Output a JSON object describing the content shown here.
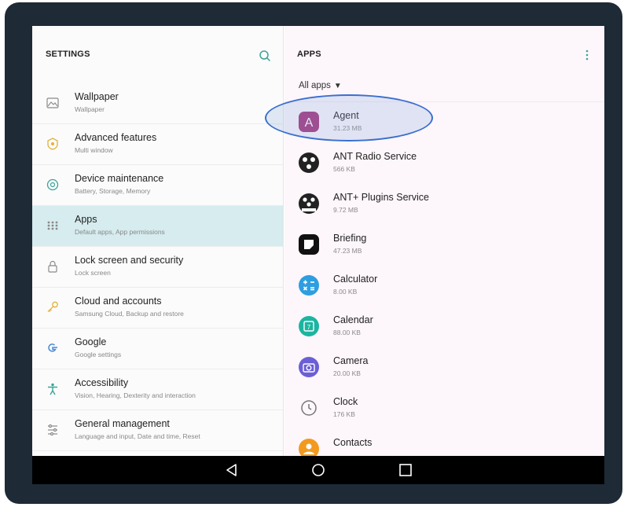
{
  "settings": {
    "title": "SETTINGS",
    "items": [
      {
        "label": "Wallpaper",
        "sub": "Wallpaper",
        "icon": "wallpaper-icon"
      },
      {
        "label": "Advanced features",
        "sub": "Multi window",
        "icon": "advanced-features-icon"
      },
      {
        "label": "Device maintenance",
        "sub": "Battery, Storage, Memory",
        "icon": "device-maintenance-icon"
      },
      {
        "label": "Apps",
        "sub": "Default apps, App permissions",
        "icon": "apps-icon",
        "selected": true
      },
      {
        "label": "Lock screen and security",
        "sub": "Lock screen",
        "icon": "lock-icon"
      },
      {
        "label": "Cloud and accounts",
        "sub": "Samsung Cloud, Backup and restore",
        "icon": "key-icon"
      },
      {
        "label": "Google",
        "sub": "Google settings",
        "icon": "google-icon"
      },
      {
        "label": "Accessibility",
        "sub": "Vision, Hearing, Dexterity and interaction",
        "icon": "accessibility-icon"
      },
      {
        "label": "General management",
        "sub": "Language and input, Date and time, Reset",
        "icon": "general-management-icon"
      }
    ]
  },
  "apps": {
    "title": "APPS",
    "filter": "All apps",
    "list": [
      {
        "name": "Agent",
        "size": "31.23 MB",
        "icon": "agent-icon",
        "color": "#a3307a"
      },
      {
        "name": "ANT Radio Service",
        "size": "566 KB",
        "icon": "ant-radio-icon",
        "color": "#222222"
      },
      {
        "name": "ANT+ Plugins Service",
        "size": "9.72 MB",
        "icon": "ant-plugins-icon",
        "color": "#222222"
      },
      {
        "name": "Briefing",
        "size": "47.23 MB",
        "icon": "briefing-icon",
        "color": "#111111"
      },
      {
        "name": "Calculator",
        "size": "8.00 KB",
        "icon": "calculator-icon",
        "color": "#2d9ee0"
      },
      {
        "name": "Calendar",
        "size": "88.00 KB",
        "icon": "calendar-icon",
        "color": "#1bb5a0"
      },
      {
        "name": "Camera",
        "size": "20.00 KB",
        "icon": "camera-icon",
        "color": "#6b5fd6"
      },
      {
        "name": "Clock",
        "size": "176 KB",
        "icon": "clock-icon",
        "color": "#777777"
      },
      {
        "name": "Contacts",
        "size": "",
        "icon": "contacts-icon",
        "color": "#f29a1f"
      }
    ]
  },
  "colors": {
    "selected_bg": "#d6ecef",
    "highlight": "#3a6fcf",
    "device_frame": "#1e2a36"
  }
}
